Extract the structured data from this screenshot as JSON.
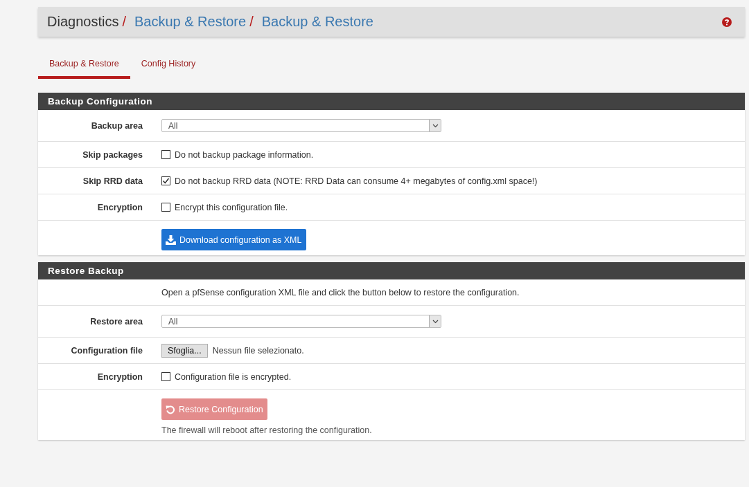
{
  "breadcrumb": [
    {
      "text": "Diagnostics",
      "link": false
    },
    {
      "separator": "/",
      "text": "Backup & Restore",
      "link": true
    },
    {
      "separator": "/",
      "text": "Backup & Restore",
      "link": true
    }
  ],
  "tabs": [
    {
      "label": "Backup & Restore",
      "selected": true
    },
    {
      "label": "Config History",
      "selected": false
    }
  ],
  "panels": [
    {
      "title": "Backup Configuration",
      "rows": [
        {
          "kind": "select",
          "label": "Backup area",
          "value": "All"
        },
        {
          "kind": "checkbox",
          "label": "Skip packages",
          "text": "Do not backup package information.",
          "checked": false
        },
        {
          "kind": "checkbox",
          "label": "Skip RRD data",
          "text": "Do not backup RRD data (NOTE: RRD Data can consume 4+ megabytes of config.xml space!)",
          "checked": true
        },
        {
          "kind": "checkbox",
          "label": "Encryption",
          "text": "Encrypt this configuration file.",
          "checked": false
        },
        {
          "kind": "download",
          "text": "Download configuration as XML",
          "disabled": false
        }
      ]
    },
    {
      "title": "Restore Backup",
      "rows": [
        {
          "kind": "text",
          "text": "Open a pfSense configuration XML file and click the button below to restore the configuration."
        },
        {
          "kind": "select",
          "label": "Restore area",
          "value": "All"
        },
        {
          "kind": "file",
          "label": "Configuration file",
          "button": "Sfoglia...",
          "text": "Nessun file selezionato."
        },
        {
          "kind": "checkbox",
          "label": "Encryption",
          "text": "Configuration file is encrypted.",
          "checked": false
        },
        {
          "kind": "restore",
          "text": "Restore Configuration",
          "disabled": true,
          "note": "The firewall will reboot after restoring the configuration."
        }
      ]
    }
  ]
}
